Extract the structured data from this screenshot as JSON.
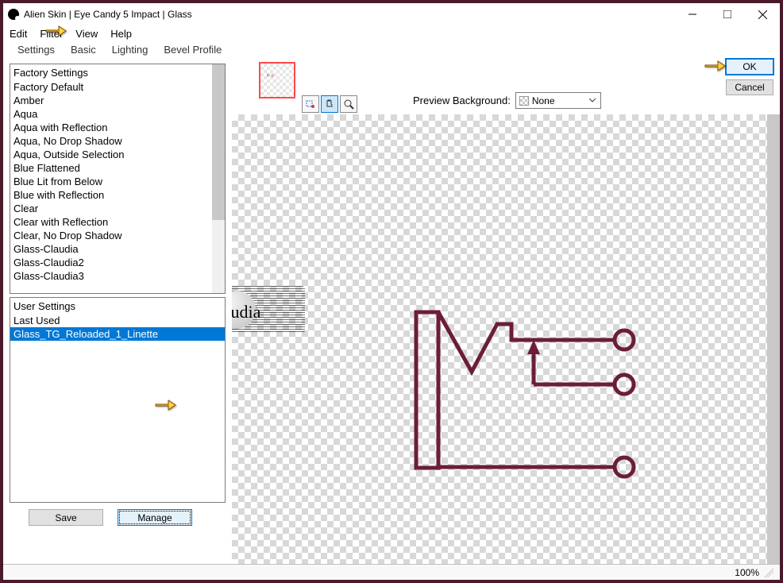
{
  "window": {
    "title": "Alien Skin | Eye Candy 5 Impact | Glass"
  },
  "menu": {
    "edit": "Edit",
    "filter": "Filter",
    "view": "View",
    "help": "Help"
  },
  "tabs": {
    "settings": "Settings",
    "basic": "Basic",
    "lighting": "Lighting",
    "bevel": "Bevel Profile"
  },
  "factory": {
    "header": "Factory Settings",
    "items": [
      "Factory Default",
      "Amber",
      "Aqua",
      "Aqua with Reflection",
      "Aqua, No Drop Shadow",
      "Aqua, Outside Selection",
      "Blue Flattened",
      "Blue Lit from Below",
      "Blue with Reflection",
      "Clear",
      "Clear with Reflection",
      "Clear, No Drop Shadow",
      "Glass-Claudia",
      "Glass-Claudia2",
      "Glass-Claudia3"
    ]
  },
  "user": {
    "header": "User Settings",
    "items": [
      "Last Used",
      "Glass_TG_Reloaded_1_Linette"
    ],
    "selected": 1
  },
  "buttons": {
    "save": "Save",
    "manage": "Manage",
    "ok": "OK",
    "cancel": "Cancel"
  },
  "preview": {
    "label": "Preview Background:",
    "value": "None"
  },
  "status": {
    "zoom": "100%"
  },
  "watermark": "Claudia"
}
